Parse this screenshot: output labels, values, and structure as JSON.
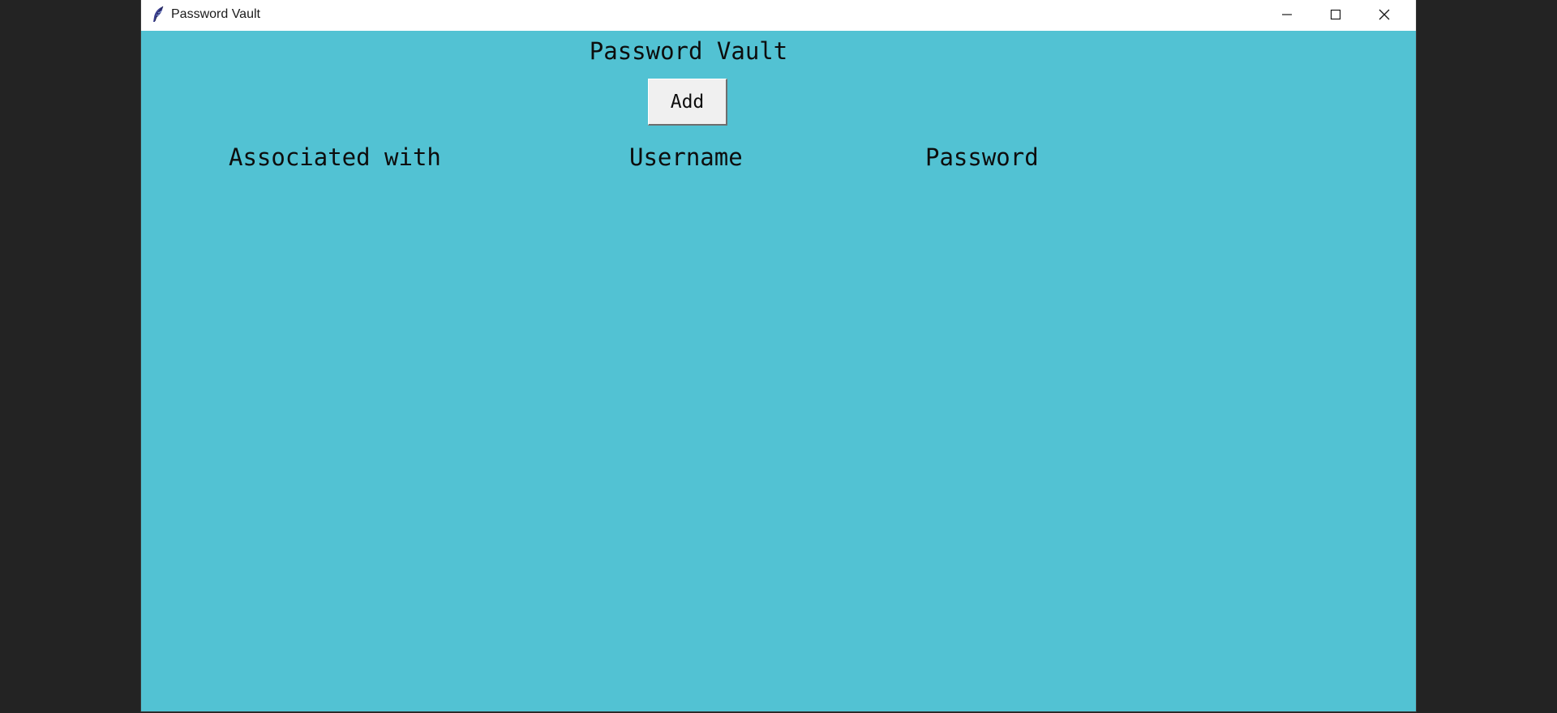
{
  "window": {
    "title": "Password Vault",
    "icon": "feather-icon",
    "controls": [
      "minimize-icon",
      "maximize-icon",
      "close-icon"
    ]
  },
  "colors": {
    "background": "#52c2d3",
    "button": "#f0f0f0",
    "text": "#0d0d0d"
  },
  "main": {
    "heading": "Password Vault",
    "add_label": "Add",
    "columns": [
      "Associated with",
      "Username",
      "Password"
    ]
  }
}
